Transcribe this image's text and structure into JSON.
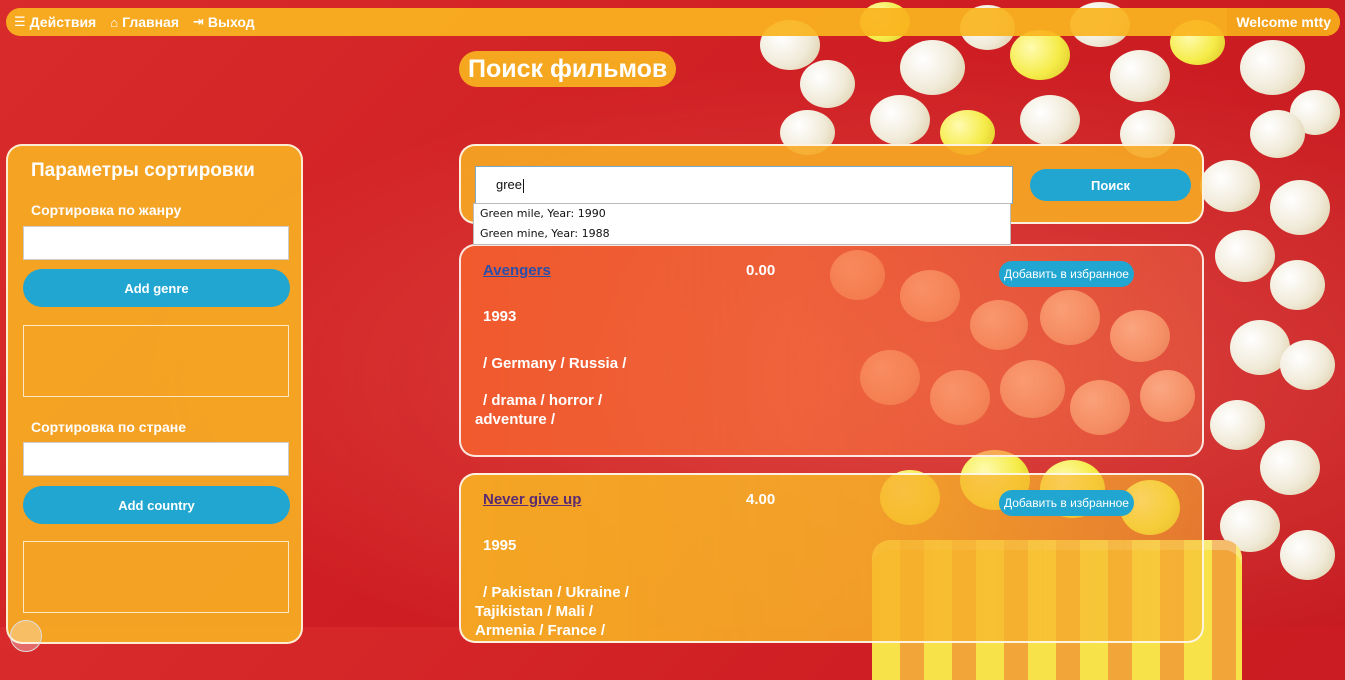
{
  "nav": {
    "items": [
      {
        "icon": "list-icon",
        "label": "Действия"
      },
      {
        "icon": "home-icon",
        "label": "Главная"
      },
      {
        "icon": "sign-out-icon",
        "label": "Выход"
      }
    ],
    "welcome": "Welcome mtty"
  },
  "page_title": "Поиск фильмов",
  "sort_panel": {
    "title": "Параметры сортировки",
    "genre_label": "Сортировка по жанру",
    "genre_value": "",
    "add_genre": "Add genre",
    "country_label": "Сортировка по стране",
    "country_value": "",
    "add_country": "Add country"
  },
  "search": {
    "value": "gree",
    "button": "Поиск",
    "suggestions": [
      "Green mile, Year: 1990",
      "Green mine, Year: 1988"
    ]
  },
  "movies": [
    {
      "title": "Avengers",
      "rating": "0.00",
      "fav": "Добавить в избранное",
      "year": "1993",
      "countries": "/ Germany / Russia /",
      "genres_1": "/ drama / horror /",
      "genres_2": "adventure /"
    },
    {
      "title": "Never give up",
      "rating": "4.00",
      "fav": "Добавить в избранное",
      "year": "1995",
      "countries_1": "/ Pakistan / Ukraine /",
      "countries_2": "Tajikistan / Mali /",
      "countries_3": "Armenia / France /"
    }
  ],
  "colors": {
    "accent_orange": "#f6aa23",
    "button_blue": "#21a6d1",
    "background_red": "#cf1f24"
  }
}
